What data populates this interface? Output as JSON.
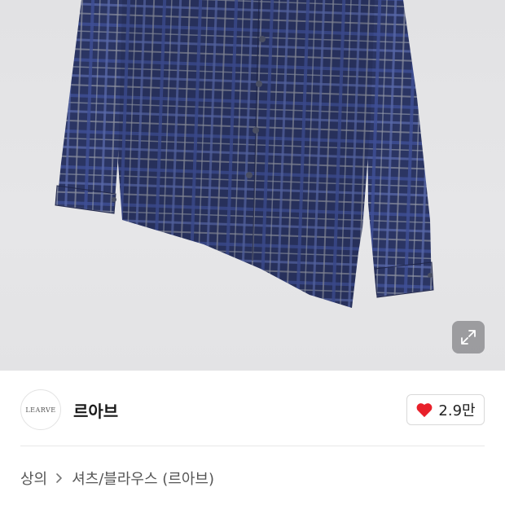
{
  "seller": {
    "logo_text": "LEARVE",
    "name": "르아브"
  },
  "like": {
    "count": "2.9만",
    "heart_color": "#e8202a"
  },
  "breadcrumb": {
    "items": [
      "상의",
      "셔츠/블라우스 (르아브)"
    ]
  },
  "icons": {
    "expand": "expand-arrows-icon",
    "heart": "heart-icon",
    "separator": "chevron-right-icon"
  },
  "image": {
    "subject": "navy plaid long-sleeve shirt",
    "background_color": "#e4e4e6"
  }
}
